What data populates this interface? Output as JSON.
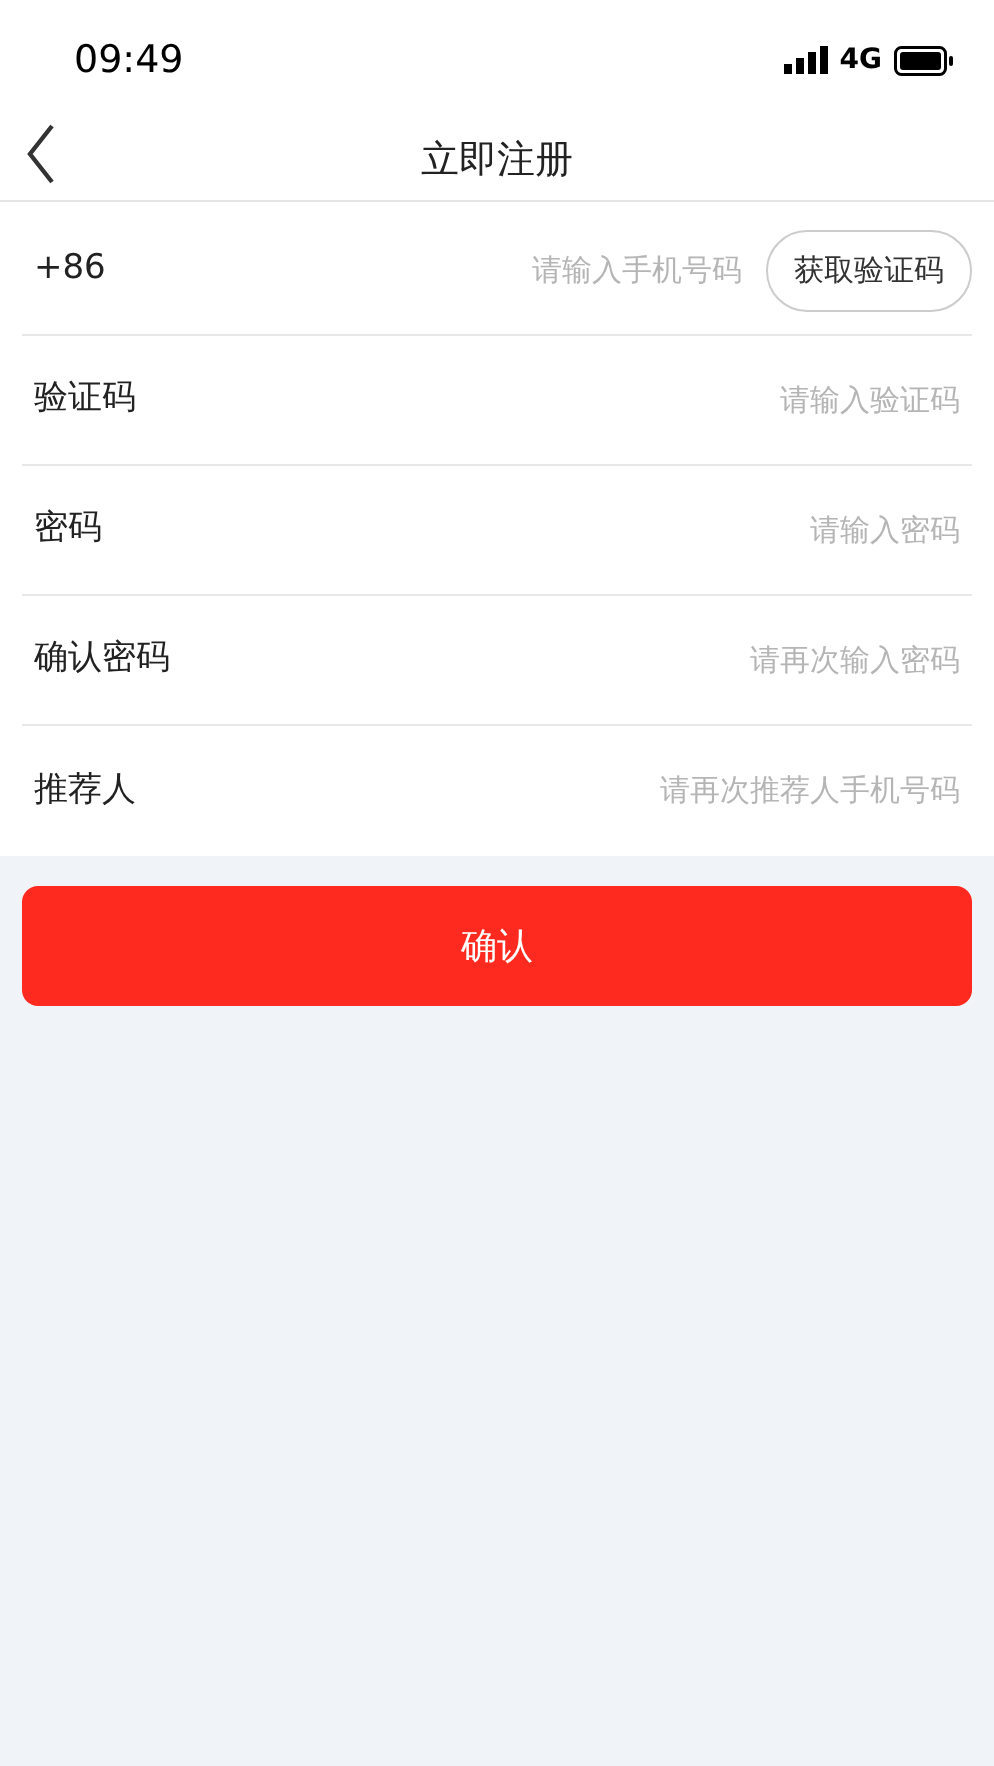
{
  "status_bar": {
    "time": "09:49",
    "network": "4G"
  },
  "header": {
    "title": "立即注册"
  },
  "form": {
    "rows": [
      {
        "kind": "phone",
        "label": "+86",
        "placeholder": "请输入手机号码",
        "button": "获取验证码"
      },
      {
        "kind": "text",
        "label": "验证码",
        "placeholder": "请输入验证码"
      },
      {
        "kind": "text",
        "label": "密码",
        "placeholder": "请输入密码"
      },
      {
        "kind": "text",
        "label": "确认密码",
        "placeholder": "请再次输入密码"
      },
      {
        "kind": "text",
        "label": "推荐人",
        "placeholder": "请再次推荐人手机号码"
      }
    ]
  },
  "submit_button": "确认"
}
